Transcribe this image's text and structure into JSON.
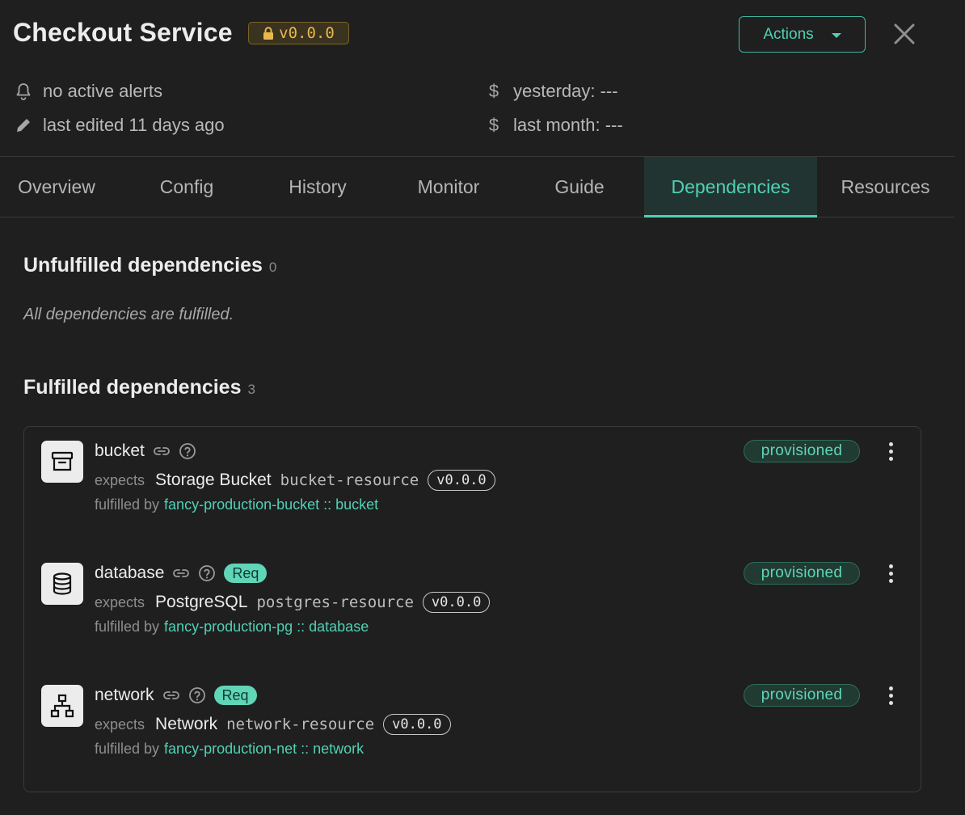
{
  "header": {
    "title": "Checkout Service",
    "version": "v0.0.0",
    "actions_label": "Actions",
    "alerts": "no active alerts",
    "last_edited": "last edited 11 days ago",
    "cost_yesterday": "yesterday: ---",
    "cost_last_month": "last month: ---",
    "dollar_symbol": "$"
  },
  "tabs": [
    {
      "label": "Overview"
    },
    {
      "label": "Config"
    },
    {
      "label": "History"
    },
    {
      "label": "Monitor"
    },
    {
      "label": "Guide"
    },
    {
      "label": "Dependencies",
      "active": true
    },
    {
      "label": "Resources"
    }
  ],
  "unfulfilled": {
    "title": "Unfulfilled dependencies",
    "count": "0",
    "empty_text": "All dependencies are fulfilled."
  },
  "fulfilled": {
    "title": "Fulfilled dependencies",
    "count": "3",
    "items": [
      {
        "name": "bucket",
        "icon": "archive-box-icon",
        "required": false,
        "expects_label": "expects",
        "kind": "Storage Bucket",
        "resource": "bucket-resource",
        "version": "v0.0.0",
        "fulfilled_label": "fulfilled by",
        "fulfilled_by": "fancy-production-bucket :: bucket",
        "status": "provisioned"
      },
      {
        "name": "database",
        "icon": "database-icon",
        "required": true,
        "req_label": "Req",
        "expects_label": "expects",
        "kind": "PostgreSQL",
        "resource": "postgres-resource",
        "version": "v0.0.0",
        "fulfilled_label": "fulfilled by",
        "fulfilled_by": "fancy-production-pg :: database",
        "status": "provisioned"
      },
      {
        "name": "network",
        "icon": "network-icon",
        "required": true,
        "req_label": "Req",
        "expects_label": "expects",
        "kind": "Network",
        "resource": "network-resource",
        "version": "v0.0.0",
        "fulfilled_label": "fulfilled by",
        "fulfilled_by": "fancy-production-net :: network",
        "status": "provisioned"
      }
    ]
  },
  "colors": {
    "accent": "#4fd1b5",
    "background": "#1f1f1f",
    "version_badge": "#e8b84a"
  }
}
